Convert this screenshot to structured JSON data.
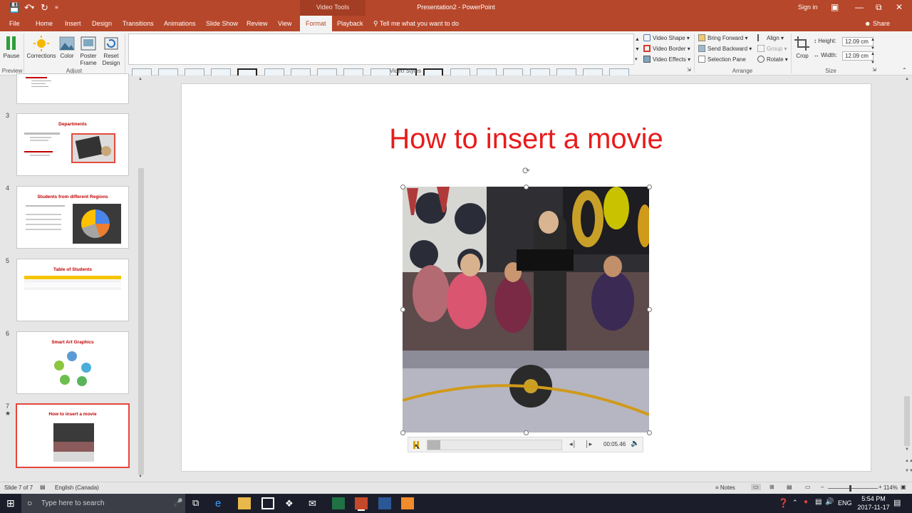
{
  "qat": {
    "save_icon": "save-icon",
    "undo_icon": "undo-icon",
    "redo_icon": "redo-icon",
    "customize_icon": "customize-icon"
  },
  "window": {
    "title": "Presentation2 - PowerPoint",
    "context_header": "Video Tools",
    "sign_in": "Sign in"
  },
  "tabs": [
    "File",
    "Home",
    "Insert",
    "Design",
    "Transitions",
    "Animations",
    "Slide Show",
    "Review",
    "View",
    "Format",
    "Playback"
  ],
  "tell_me": "Tell me what you want to do",
  "share": "Share",
  "ribbon": {
    "pause": "Pause",
    "preview_group": "Preview",
    "corrections": "Corrections",
    "color": "Color",
    "poster_frame": "Poster Frame",
    "reset_design": "Reset Design",
    "adjust_group": "Adjust",
    "video_styles_group": "Video Styles",
    "video_shape": "Video Shape",
    "video_border": "Video Border",
    "video_effects": "Video Effects",
    "bring_forward": "Bring Forward",
    "send_backward": "Send Backward",
    "selection_pane": "Selection Pane",
    "align": "Align",
    "group": "Group",
    "rotate": "Rotate",
    "arrange_group": "Arrange",
    "crop": "Crop",
    "height_label": "Height:",
    "height_value": "12.09 cm",
    "width_label": "Width:",
    "width_value": "12.09 cm",
    "size_group": "Size",
    "accent": "#b7472a"
  },
  "slides": [
    {
      "num": "3",
      "title": "Departments"
    },
    {
      "num": "4",
      "title": "Students from different Regions"
    },
    {
      "num": "5",
      "title": "Table of Students"
    },
    {
      "num": "6",
      "title": "Smart Art Graphics"
    },
    {
      "num": "7",
      "title": "How to insert a movie"
    }
  ],
  "main": {
    "slide_title": "How to insert a movie",
    "video_time": "00:05.46",
    "title_color": "#e81b1b"
  },
  "status": {
    "slide_info": "Slide 7 of 7",
    "language": "English (Canada)",
    "notes": "Notes",
    "zoom": "114%"
  },
  "taskbar": {
    "search_placeholder": "Type here to search",
    "lang": "ENG",
    "time": "5:54 PM",
    "date": "2017-11-17"
  }
}
